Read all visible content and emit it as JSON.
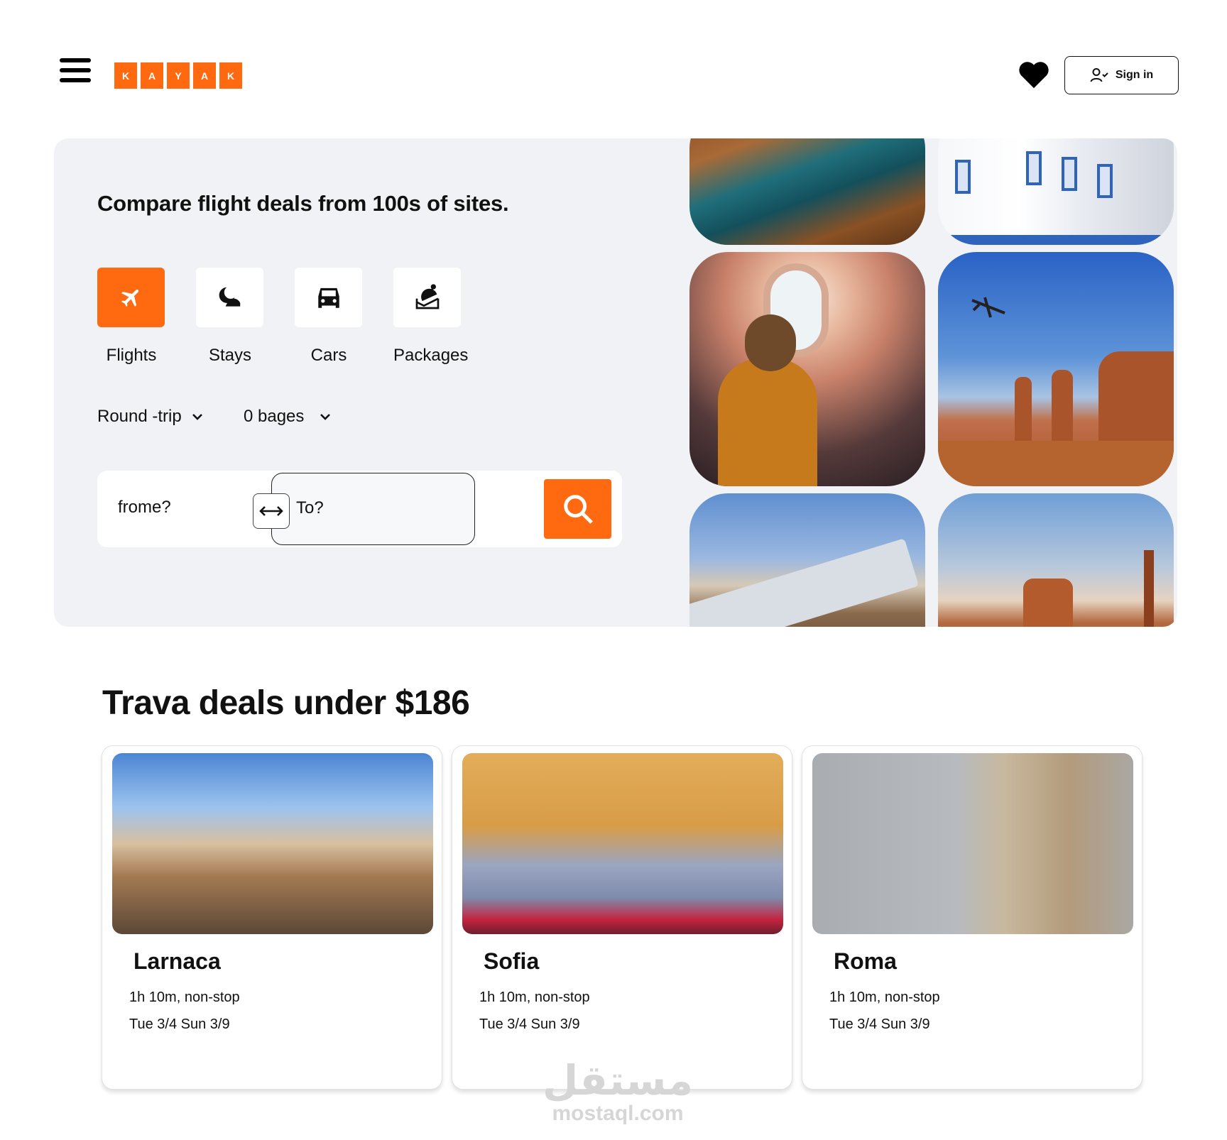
{
  "brand": {
    "logo_letters": [
      "K",
      "A",
      "Y",
      "A",
      "K"
    ],
    "accent": "#ff690f"
  },
  "header": {
    "signin_label": "Sign in"
  },
  "hero": {
    "title": "Compare flight deals from 100s of sites.",
    "verticals": [
      {
        "label": "Flights",
        "icon": "airplane-icon",
        "active": true
      },
      {
        "label": "Stays",
        "icon": "moon-bed-icon",
        "active": false
      },
      {
        "label": "Cars",
        "icon": "car-icon",
        "active": false
      },
      {
        "label": "Packages",
        "icon": "package-icon",
        "active": false
      }
    ],
    "trip_type": "Round -trip",
    "bags": "0 bages",
    "search": {
      "from_placeholder": "frome?",
      "to_placeholder": "To?"
    }
  },
  "deals": {
    "title": "Trava deals under $186",
    "cards": [
      {
        "city": "Larnaca",
        "duration": "1h 10m, non-stop",
        "dates": "Tue 3/4 Sun 3/9"
      },
      {
        "city": "Sofia",
        "duration": "1h 10m, non-stop",
        "dates": "Tue 3/4 Sun 3/9"
      },
      {
        "city": "Roma",
        "duration": "1h 10m, non-stop",
        "dates": "Tue 3/4 Sun 3/9"
      }
    ]
  },
  "watermark": {
    "arabic": "مستقل",
    "latin": "mostaql.com"
  }
}
